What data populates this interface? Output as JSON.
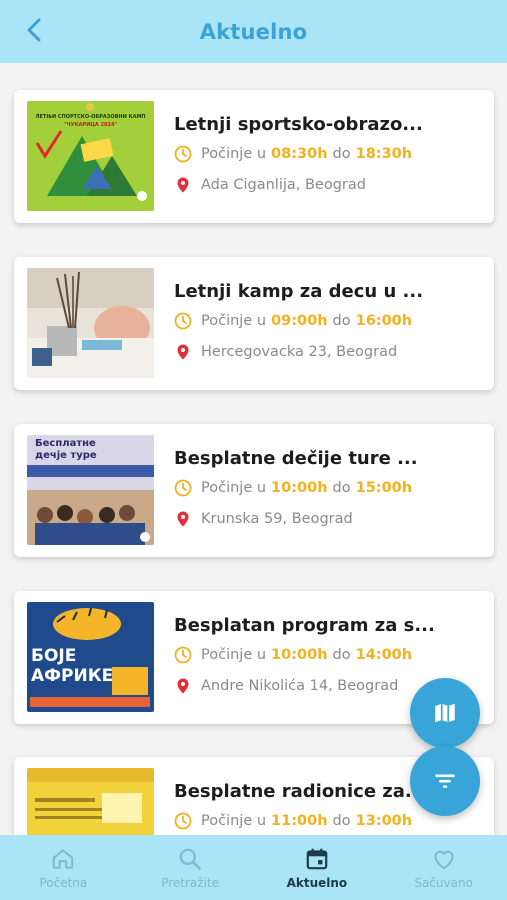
{
  "header": {
    "title": "Aktuelno",
    "back_icon": "chevron-left-icon"
  },
  "events": [
    {
      "title": "Letnji sportsko-obrazo...",
      "time_prefix": "Počinje u",
      "start": "08:30h",
      "time_sep": "do",
      "end": "18:30h",
      "location": "Ada Ciganlija, Beograd",
      "thumb_text": [
        "ЛЕТЊИ СПОРТСКО-ОБРАЗОВНИ КАМП",
        "\"ЧУКАРИЦА 2024\""
      ]
    },
    {
      "title": "Letnji kamp za decu u ...",
      "time_prefix": "Počinje u",
      "start": "09:00h",
      "time_sep": "do",
      "end": "16:00h",
      "location": "Hercegovacka 23, Beograd"
    },
    {
      "title": "Besplatne dečije ture ...",
      "time_prefix": "Počinje u",
      "start": "10:00h",
      "time_sep": "do",
      "end": "15:00h",
      "location": "Krunska 59, Beograd",
      "thumb_text": [
        "Бесплатне",
        "дечје туре"
      ]
    },
    {
      "title": "Besplatan program za s...",
      "time_prefix": "Počinje u",
      "start": "10:00h",
      "time_sep": "do",
      "end": "14:00h",
      "location": "Andre Nikolića 14, Beograd",
      "thumb_text": [
        "БОЈЕ",
        "АФРИКЕ"
      ]
    },
    {
      "title": "Besplatne radionice za...",
      "time_prefix": "Počinje u",
      "start": "11:00h",
      "time_sep": "do",
      "end": "13:00h",
      "location": ""
    }
  ],
  "fabs": {
    "map_icon": "map-icon",
    "filter_icon": "filter-icon"
  },
  "nav": {
    "items": [
      {
        "label": "Početna",
        "icon": "home-icon"
      },
      {
        "label": "Pretražite",
        "icon": "search-icon"
      },
      {
        "label": "Aktuelno",
        "icon": "calendar-icon",
        "active": true
      },
      {
        "label": "Sačuvano",
        "icon": "heart-icon"
      }
    ]
  },
  "colors": {
    "header_bg": "#a9e4f7",
    "accent": "#39a4d8",
    "time": "#f2b11f",
    "pin": "#e2303a"
  }
}
